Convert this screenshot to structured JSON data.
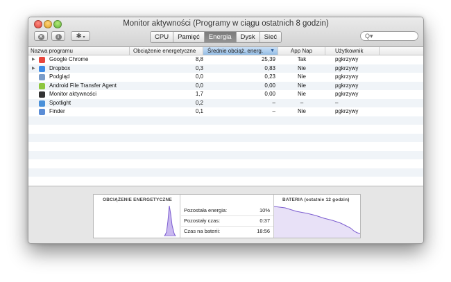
{
  "window": {
    "title": "Monitor aktywności (Programy w ciągu ostatnich 8 godzin)"
  },
  "toolbar": {
    "icons": [
      "close-circle-icon",
      "info-icon",
      "gear-icon"
    ],
    "tabs": [
      {
        "label": "CPU",
        "active": false
      },
      {
        "label": "Pamięć",
        "active": false
      },
      {
        "label": "Energia",
        "active": true
      },
      {
        "label": "Dysk",
        "active": false
      },
      {
        "label": "Sieć",
        "active": false
      }
    ],
    "search_glyph": "Q▾"
  },
  "table": {
    "columns": [
      "Nazwa programu",
      "Obciążenie energetyczne",
      "Średnie obciąż. energ.",
      "App Nap",
      "Użytkownik"
    ],
    "sort_indicator": "▼",
    "rows": [
      {
        "name": "Google Chrome",
        "expand": "▶",
        "icon": "chrome-icon",
        "icon_color": "#e8453c",
        "load": "8,8",
        "avg": "25,39",
        "nap": "Tak",
        "user": "pgkrzywy"
      },
      {
        "name": "Dropbox",
        "expand": "▶",
        "icon": "dropbox-icon",
        "icon_color": "#3d8be6",
        "load": "0,3",
        "avg": "0,83",
        "nap": "Nie",
        "user": "pgkrzywy"
      },
      {
        "name": "Podgląd",
        "expand": "",
        "icon": "preview-icon",
        "icon_color": "#7a9cc9",
        "load": "0,0",
        "avg": "0,23",
        "nap": "Nie",
        "user": "pgkrzywy"
      },
      {
        "name": "Android File Transfer Agent",
        "expand": "",
        "icon": "android-icon",
        "icon_color": "#8dc63f",
        "load": "0,0",
        "avg": "0,00",
        "nap": "Nie",
        "user": "pgkrzywy"
      },
      {
        "name": "Monitor aktywności",
        "expand": "",
        "icon": "activity-monitor-icon",
        "icon_color": "#333333",
        "load": "1,7",
        "avg": "0,00",
        "nap": "Nie",
        "user": "pgkrzywy"
      },
      {
        "name": "Spotlight",
        "expand": "",
        "icon": "spotlight-icon",
        "icon_color": "#4a90d9",
        "load": "0,2",
        "avg": "–",
        "nap": "–",
        "user": "–"
      },
      {
        "name": "Finder",
        "expand": "",
        "icon": "finder-icon",
        "icon_color": "#5b8dd6",
        "load": "0,1",
        "avg": "–",
        "nap": "Nie",
        "user": "pgkrzywy"
      }
    ]
  },
  "bottom": {
    "energy_title": "OBCIĄŻENIE ENERGETYCZNE",
    "stats": [
      {
        "label": "Pozostała energia:",
        "value": "10%"
      },
      {
        "label": "Pozostały czas:",
        "value": "0:37"
      },
      {
        "label": "Czas na baterii:",
        "value": "18:56"
      }
    ],
    "battery_title": "BATERIA (ostatnie 12 godzin)"
  },
  "colors": {
    "graph": "#7b5ccf",
    "graph_fill": "#c9b8f0"
  }
}
